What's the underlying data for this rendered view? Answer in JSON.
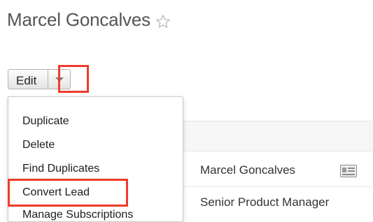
{
  "header": {
    "title": "Marcel Goncalves",
    "favorite_icon": "star-outline-icon"
  },
  "toolbar": {
    "edit_label": "Edit",
    "actions_caret_icon": "caret-down-icon"
  },
  "actions_menu": {
    "items": [
      {
        "label": "Duplicate"
      },
      {
        "label": "Delete"
      },
      {
        "label": "Find Duplicates"
      },
      {
        "label": "Convert Lead"
      },
      {
        "label": "Manage Subscriptions"
      }
    ],
    "highlighted_item": "Convert Lead"
  },
  "record": {
    "name": "Marcel Goncalves",
    "title": "Senior Product Manager",
    "vcard_icon": "vcard-icon"
  },
  "colors": {
    "highlight": "#ef3b2c",
    "text": "#333333",
    "title": "#555555"
  }
}
